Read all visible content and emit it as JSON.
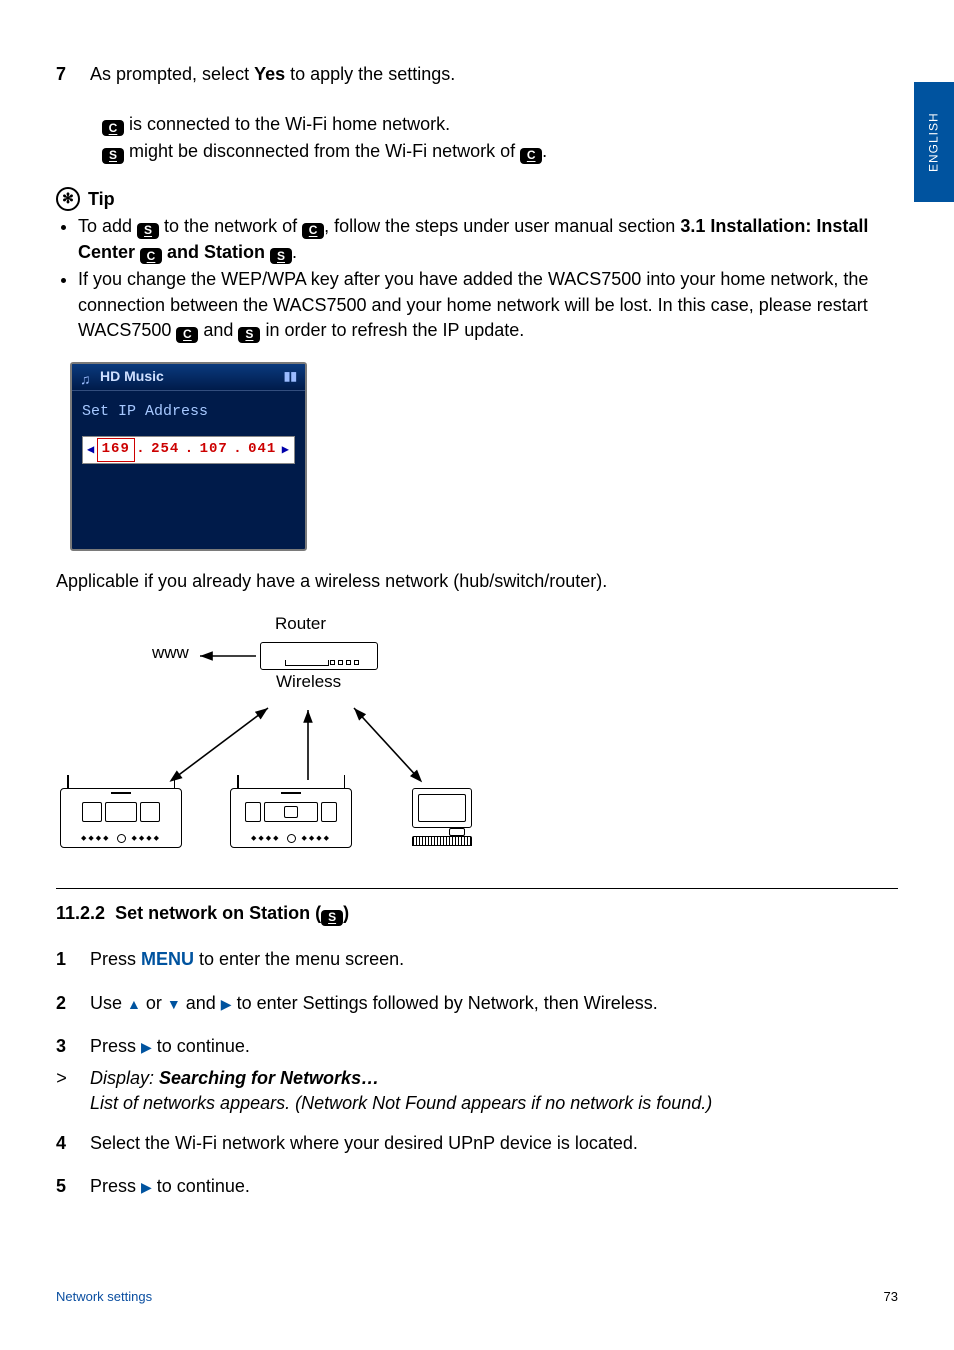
{
  "language_tab": "ENGLISH",
  "step7": {
    "num": "7",
    "before": "As prompted, select ",
    "yes": "Yes",
    "after": " to apply the settings."
  },
  "inset": {
    "line1": " is connected to the Wi-Fi home network.",
    "line2_a": " might be disconnected from the Wi-Fi network of ",
    "line2_b": "."
  },
  "tip": {
    "label": "Tip",
    "b1": {
      "a": "To add ",
      "b": " to the network of ",
      "c": ", follow the steps under user manual section ",
      "bold1": "3.1 Installation: Install Center ",
      "and": " and Station ",
      "end": "."
    },
    "b2": "If you change the WEP/WPA key after you have added the WACS7500 into your home network, the connection between the WACS7500 and your home network will be lost. In this case, please restart WACS7500 ",
    "b2_and": " and ",
    "b2_end": " in order to refresh the IP update."
  },
  "badge_c": "C",
  "badge_s": "S",
  "lcd": {
    "title": "HD Music",
    "signal": "▮▮",
    "label": "Set IP Address",
    "ip": {
      "a": "169",
      "b": "254",
      "c": "107",
      "d": "041"
    }
  },
  "applicable": "Applicable if you already have a wireless network (hub/switch/router).",
  "diagram": {
    "router": "Router",
    "www": "www",
    "wireless": "Wireless"
  },
  "section": {
    "num": "11.2.2",
    "title": "Set network on Station ("
  },
  "steps": {
    "s1": {
      "n": "1",
      "a": "Press ",
      "menu": "MENU",
      "b": " to enter the menu screen."
    },
    "s2": {
      "n": "2",
      "a": "Use ",
      "b": " or ",
      "c": " and ",
      "d": " to enter Settings followed by Network, then Wireless."
    },
    "s3": {
      "n": "3",
      "a": "Press ",
      "b": " to continue."
    },
    "result": {
      "gt": ">",
      "a": "Display: ",
      "bold": "Searching for Networks…",
      "b": "List of networks appears. (Network Not Found appears if no network is found.)"
    },
    "s4": {
      "n": "4",
      "t": "Select the Wi-Fi network where your desired UPnP device is located."
    },
    "s5": {
      "n": "5",
      "a": "Press ",
      "b": " to continue."
    }
  },
  "footer": {
    "left": "Network settings",
    "right": "73"
  }
}
